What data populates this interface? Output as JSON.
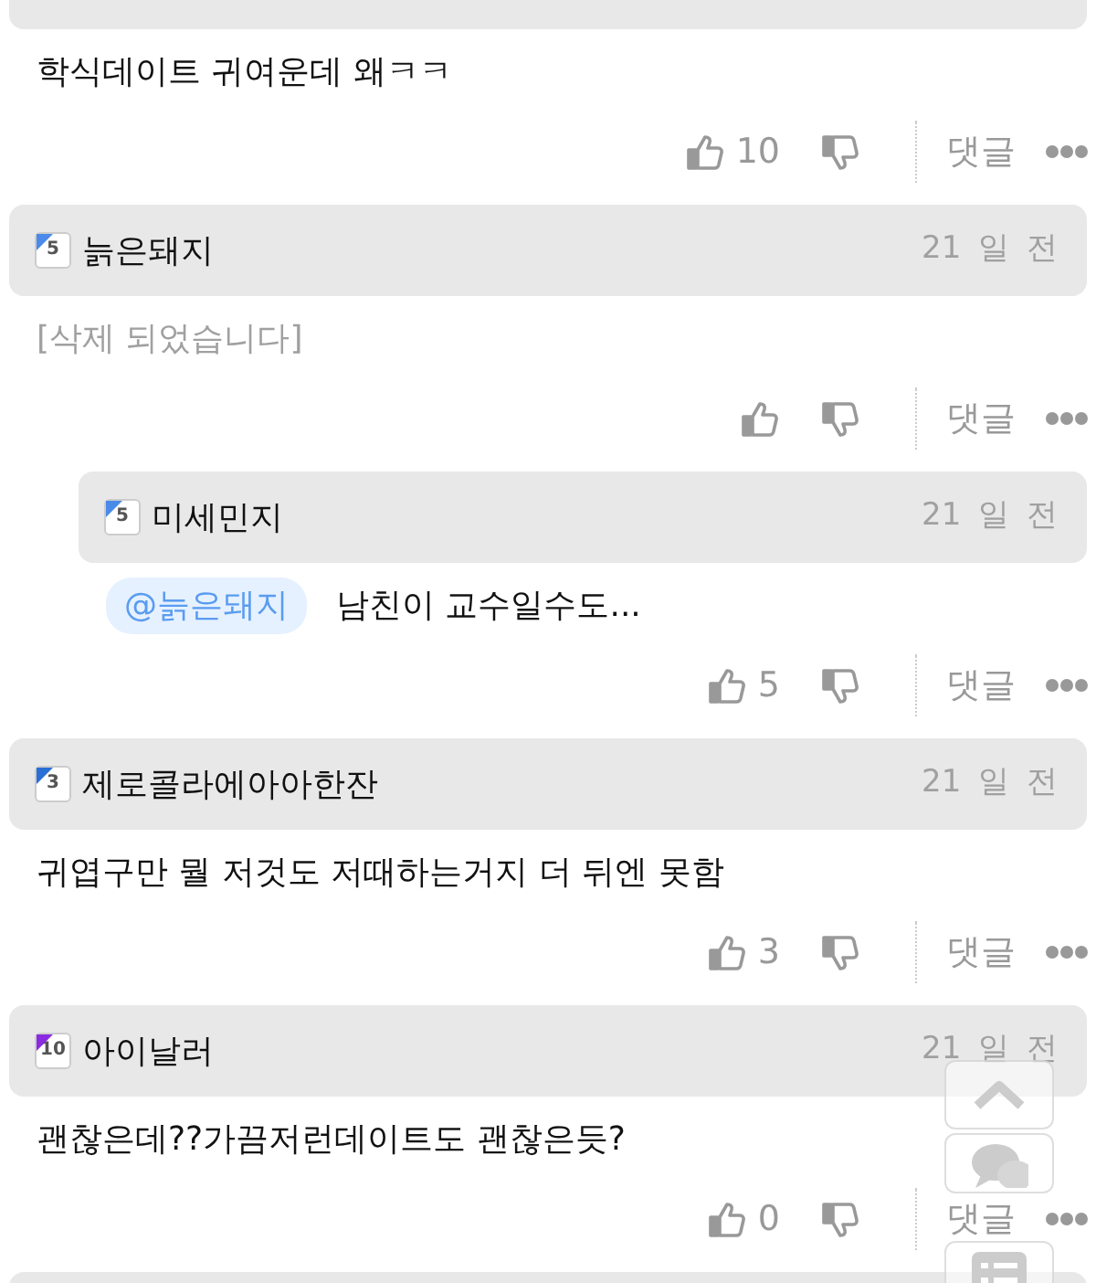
{
  "top_fragment": {
    "body": "학식데이트 귀여운데 왜ㅋㅋ",
    "likes": "10",
    "reply_label": "댓글"
  },
  "comments": [
    {
      "author": "늙은돼지",
      "level": "5",
      "color": "#4a8ae8",
      "time": "21 일 전",
      "deleted": true,
      "body": "[삭제 되었습니다]",
      "reply_label": "댓글",
      "children": [
        {
          "author": "미세민지",
          "level": "5",
          "color": "#4a8ae8",
          "time": "21 일 전",
          "deleted": false,
          "mention": "@늙은돼지",
          "body": "남친이 교수일수도...",
          "likes": "5",
          "reply_label": "댓글"
        }
      ]
    },
    {
      "author": "제로콜라에아아한잔",
      "level": "3",
      "color": "#2a6fd6",
      "time": "21 일 전",
      "deleted": false,
      "body": "귀엽구만 뭘 저것도 저때하는거지 더 뒤엔 못함",
      "likes": "3",
      "reply_label": "댓글"
    },
    {
      "author": "아이날러",
      "level": "10",
      "color": "#8a2be2",
      "time": "21 일 전",
      "deleted": false,
      "body": "괜찮은데??가끔저런데이트도 괜찮은듯?",
      "likes": "0",
      "reply_label": "댓글"
    }
  ]
}
